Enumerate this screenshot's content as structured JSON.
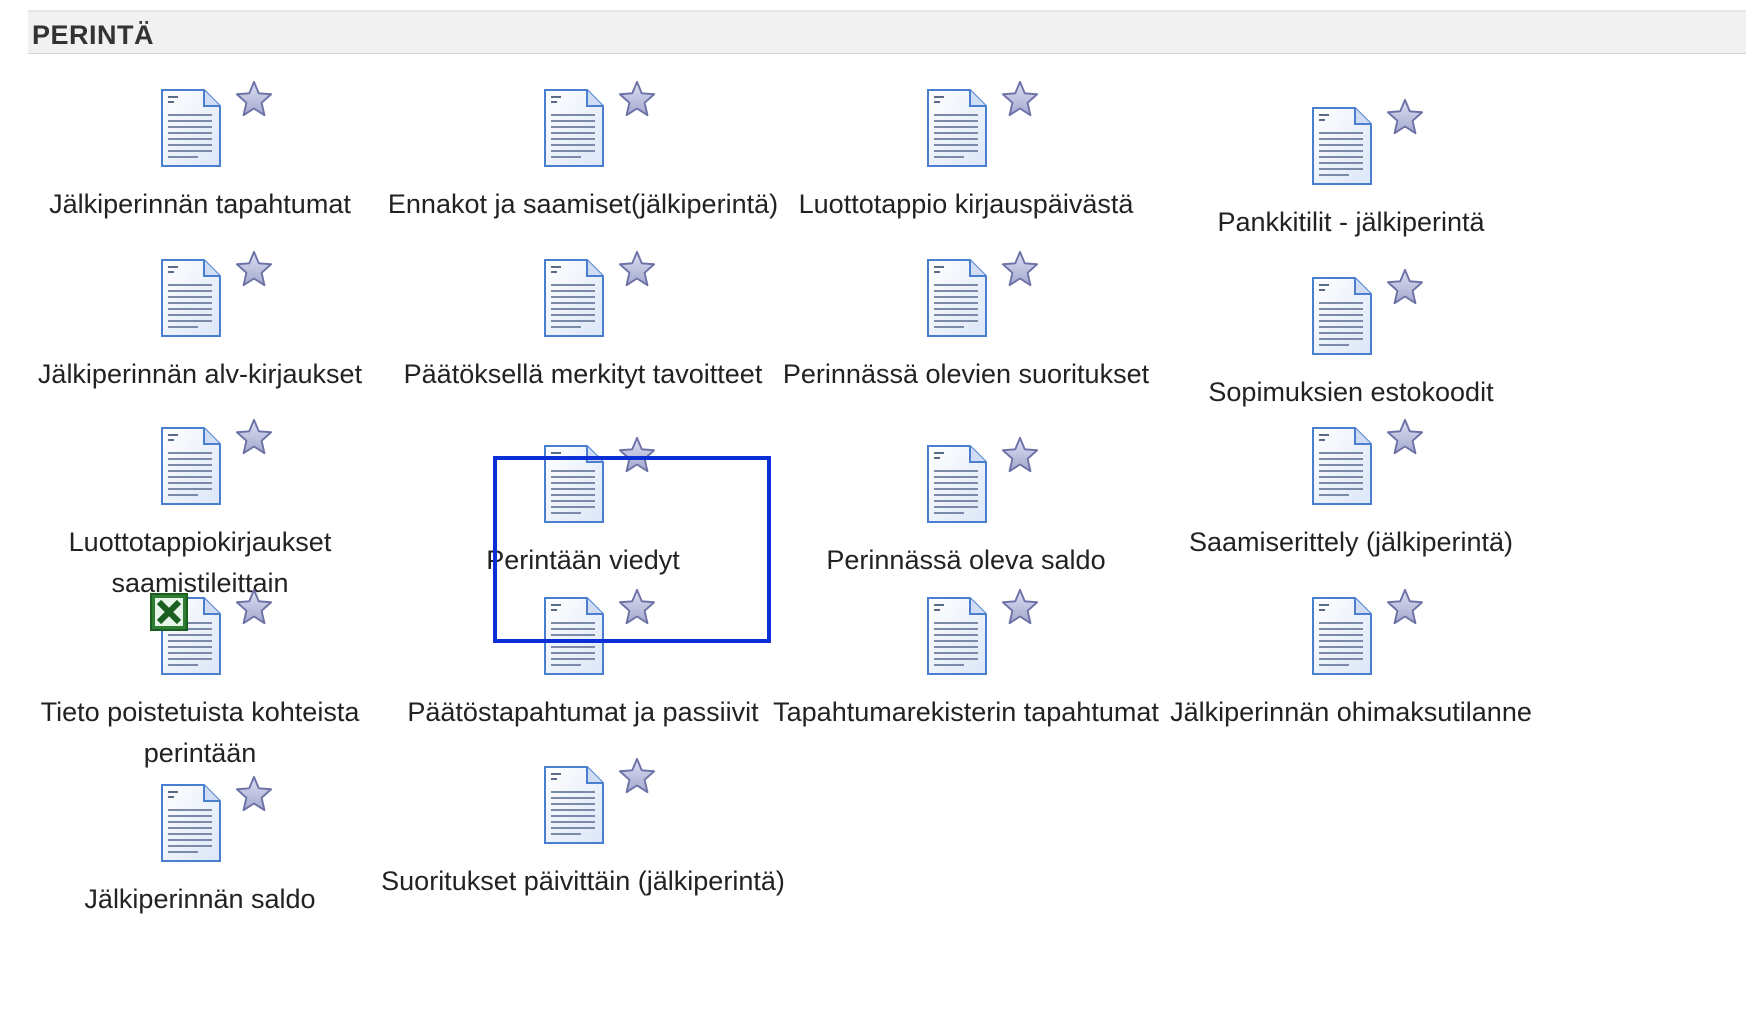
{
  "section": {
    "title": "PERINTÄ"
  },
  "icons": {
    "document": "report-document-icon",
    "favorite": "favorite-star-icon",
    "excel": "excel-icon"
  },
  "colors": {
    "highlight": "#0a2fd6",
    "star_fill": "#b7bbdc",
    "star_stroke": "#6d72a6",
    "doc_blue": "#4a7fcf"
  },
  "reports": [
    {
      "label": "Jälkiperinnän tapahtumat"
    },
    {
      "label": "Ennakot ja saamiset(jälkiperintä)"
    },
    {
      "label": "Luottotappio kirjauspäivästä"
    },
    {
      "label": "Pankkitilit - jälkiperintä"
    },
    {
      "label": "Jälkiperinnän alv-kirjaukset"
    },
    {
      "label": "Päätöksellä merkityt tavoitteet"
    },
    {
      "label": "Perinnässä olevien suoritukset"
    },
    {
      "label": "Sopimuksien estokoodit"
    },
    {
      "label": "Luottotappiokirjaukset saamistileittain"
    },
    {
      "label": "Perintään viedyt",
      "selected": true
    },
    {
      "label": "Perinnässä oleva saldo"
    },
    {
      "label": "Saamiserittely (jälkiperintä)"
    },
    {
      "label": "Tieto poistetuista kohteista perintään",
      "excel": true
    },
    {
      "label": "Päätöstapahtumat ja passiivit"
    },
    {
      "label": "Tapahtumarekisterin tapahtumat"
    },
    {
      "label": "Jälkiperinnän ohimaksutilanne"
    },
    {
      "label": "Jälkiperinnän saldo"
    },
    {
      "label": "Suoritukset päivittäin (jälkiperintä)"
    }
  ]
}
